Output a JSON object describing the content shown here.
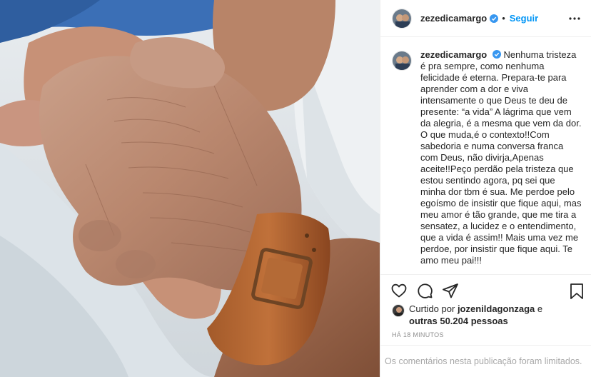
{
  "post": {
    "username": "zezedicamargo",
    "follow_label": "Seguir",
    "dot": "•",
    "caption": "Nenhuma tristeza é pra sempre, como nenhuma felicidade é eterna. Prepara-te para aprender com a dor e viva intensamente o que Deus te deu de presente: “a vida” A lágrima que vem da alegria, é a mesma que vem da dor. O que muda,é o contexto!!Com sabedoria e numa conversa franca com Deus, não divirja,Apenas aceite!!Peço perdão pela tristeza que estou sentindo agora, pq sei que minha dor tbm é sua. Me perdoe pelo egoísmo de insistir que fique aqui, mas meu amor é tão grande, que me tira a sensatez, a lucidez e o entendimento, que a vida é assim!! Mais uma vez me perdoe, por insistir que fique aqui. Te amo meu pai!!!",
    "likes": {
      "prefix": "Curtido por",
      "liker": "jozenildagonzaga",
      "conj": "e",
      "others": "outras 50.204 pessoas"
    },
    "timestamp": "HÁ 18 MINUTOS",
    "comments_notice": "Os comentários nesta publicação foram limitados."
  },
  "icons": {
    "verified": "verified-badge-icon",
    "more": "more-options-icon",
    "like": "heart-icon",
    "comment": "comment-icon",
    "share": "share-icon",
    "save": "bookmark-icon"
  },
  "colors": {
    "accent": "#0095f6",
    "text": "#262626",
    "muted": "#8e8e8e"
  }
}
